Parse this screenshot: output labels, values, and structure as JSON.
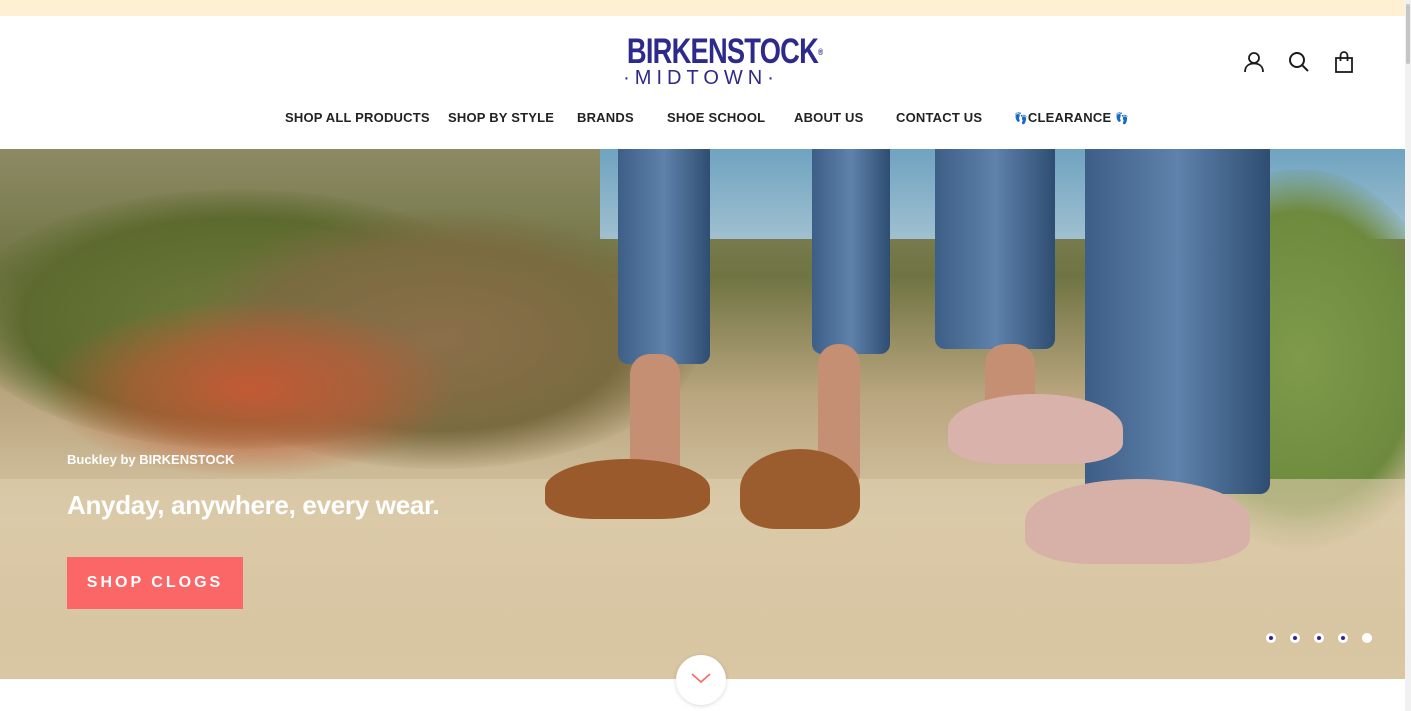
{
  "brand": {
    "name_line1": "BIRKENSTOCK",
    "registered_mark": "®",
    "name_line2": "MIDTOWN",
    "color": "#2e2a8c"
  },
  "header_icons": {
    "account": "account-icon",
    "search": "search-icon",
    "cart": "cart-icon"
  },
  "nav": {
    "items": [
      {
        "label": "SHOP ALL PRODUCTS"
      },
      {
        "label": "SHOP BY STYLE"
      },
      {
        "label": "BRANDS"
      },
      {
        "label": "SHOE SCHOOL"
      },
      {
        "label": "ABOUT US"
      },
      {
        "label": "CONTACT US"
      },
      {
        "label": "CLEARANCE",
        "prefix": "👣",
        "suffix": "👣"
      }
    ]
  },
  "hero": {
    "eyebrow": "Buckley by BIRKENSTOCK",
    "title": "Anyday, anywhere, every wear.",
    "cta": "SHOP CLOGS",
    "cta_color": "#fb6767",
    "slides_total": 5,
    "active_slide": 5
  },
  "scroll_down_icon": "chevron-down-icon",
  "colors": {
    "announcement_bar": "#fdf0d3"
  }
}
